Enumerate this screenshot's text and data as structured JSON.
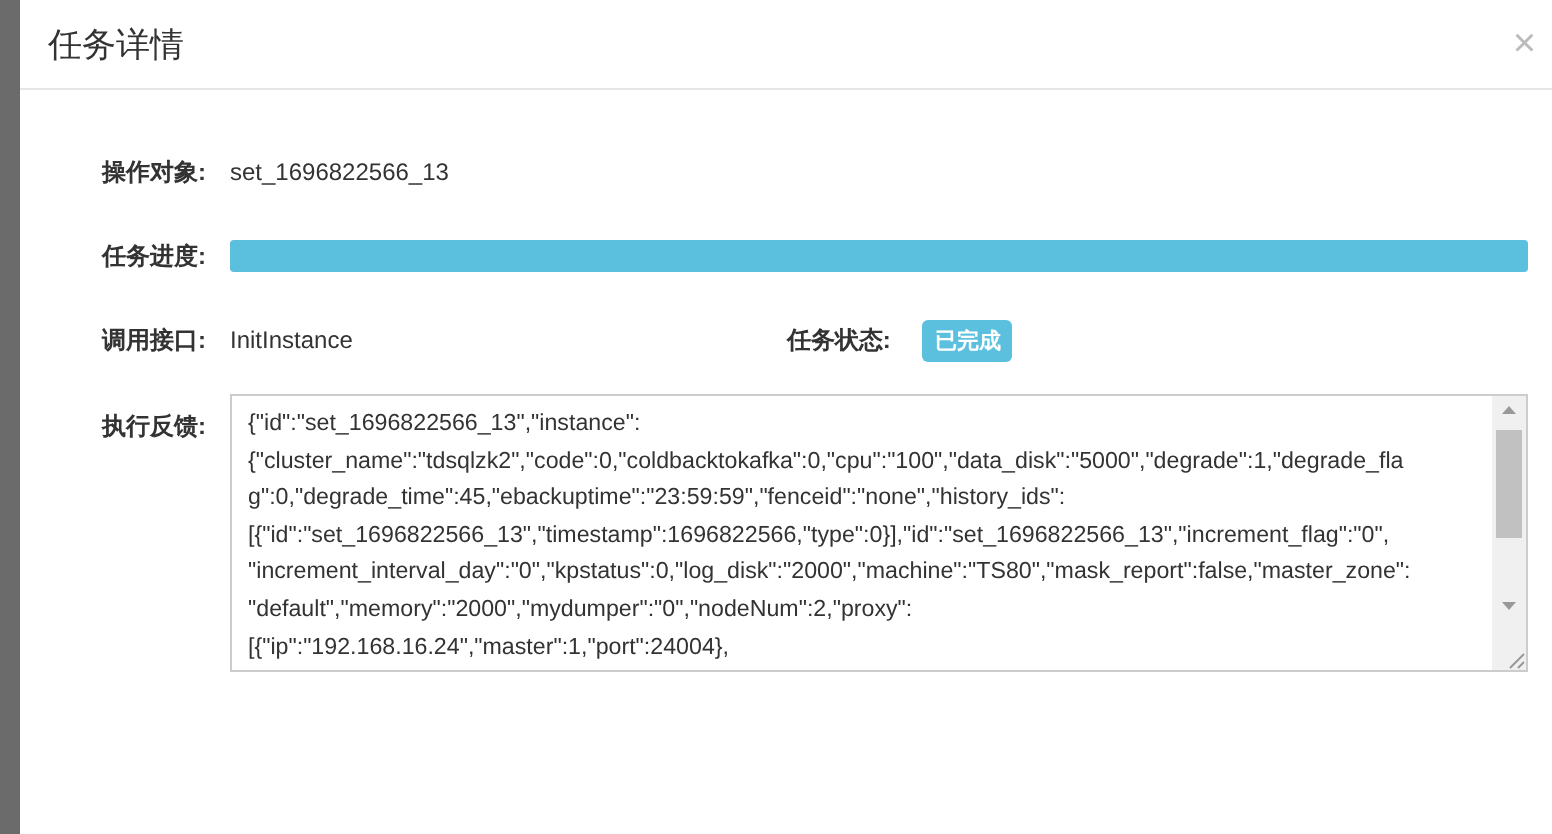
{
  "dialog": {
    "title": "任务详情",
    "close": "×"
  },
  "fields": [
    {
      "label": "操作对象:",
      "value": "set_1696822566_13"
    },
    {
      "label": "任务进度:",
      "level": 1
    },
    {
      "label": "调用接口:",
      "value": "InitInstance"
    }
  ],
  "status": {
    "label": "任务状态:",
    "badge": "已完成"
  },
  "feedback": {
    "label": "执行反馈:",
    "lines": [
      "{\"id\":\"set_1696822566_13\",\"instance\":",
      "{\"cluster_name\":\"tdsqlzk2\",\"code\":0,\"coldbacktokafka\":0,\"cpu\":\"100\",\"data_disk\":\"5000\",\"degrade\":1,\"degrade_fla",
      "g\":0,\"degrade_time\":45,\"ebackuptime\":\"23:59:59\",\"fenceid\":\"none\",\"history_ids\":",
      "[{\"id\":\"set_1696822566_13\",\"timestamp\":1696822566,\"type\":0}],\"id\":\"set_1696822566_13\",\"increment_flag\":\"0\",",
      "\"increment_interval_day\":\"0\",\"kpstatus\":0,\"log_disk\":\"2000\",\"machine\":\"TS80\",\"mask_report\":false,\"master_zone\":",
      "\"default\",\"memory\":\"2000\",\"mydumper\":\"0\",\"nodeNum\":2,\"proxy\":",
      "[{\"ip\":\"192.168.16.24\",\"master\":1,\"port\":24004},"
    ]
  }
}
